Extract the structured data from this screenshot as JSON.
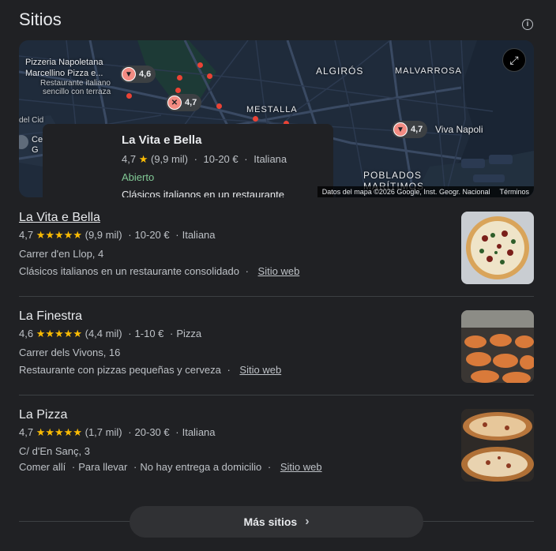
{
  "section": {
    "title": "Sitios",
    "info_icon": "info-icon"
  },
  "map": {
    "pins": [
      {
        "rating": "4,6",
        "label_lines": [
          "Pizzeria Napoletana",
          "Marcellino Pizza e..."
        ],
        "sub_lines": [
          "Restaurante italiano",
          "sencillo con terraza"
        ]
      },
      {
        "rating": "4,7"
      },
      {
        "rating": "4,7",
        "label": "Viva Napoli"
      }
    ],
    "areas": [
      "ALGIRÓS",
      "MALVARROSA",
      "MESTALLA",
      "POBLADOS",
      "MARÍTIMOS"
    ],
    "left_fragments": [
      "del Cid",
      "Ce",
      "G"
    ],
    "card": {
      "name": "La Vita e Bella",
      "rating": "4,7",
      "reviews": "(9,9 mil)",
      "price": "10-20 €",
      "category": "Italiana",
      "status": "Abierto",
      "description": "Clásicos italianos en un restaurante"
    },
    "attribution": "Datos del mapa ©2026 Google, Inst. Geogr. Nacional",
    "terms": "Términos"
  },
  "results": [
    {
      "name": "La Vita e Bella",
      "rating": "4,7",
      "reviews": "(9,9 mil)",
      "price": "10-20 €",
      "category": "Italiana",
      "address": "Carrer d'en Llop, 4",
      "description": "Clásicos italianos en un restaurante consolidado",
      "website": "Sitio web"
    },
    {
      "name": "La Finestra",
      "rating": "4,6",
      "reviews": "(4,4 mil)",
      "price": "1-10 €",
      "category": "Pizza",
      "address": "Carrer dels Vivons, 16",
      "description": "Restaurante con pizzas pequeñas y cerveza",
      "website": "Sitio web"
    },
    {
      "name": "La Pizza",
      "rating": "4,7",
      "reviews": "(1,7 mil)",
      "price": "20-30 €",
      "category": "Italiana",
      "address": "C/ d'En Sanç, 3",
      "services": [
        "Comer allí",
        "Para llevar",
        "No hay entrega a domicilio"
      ],
      "website": "Sitio web"
    }
  ],
  "stars_glyph": "★★★★★",
  "more_button": {
    "label": "Más sitios",
    "icon": "chevron-right-icon"
  },
  "colors": {
    "background": "#202124",
    "star": "#fbbc04",
    "open": "#81c995",
    "pin": "#f28b82"
  }
}
